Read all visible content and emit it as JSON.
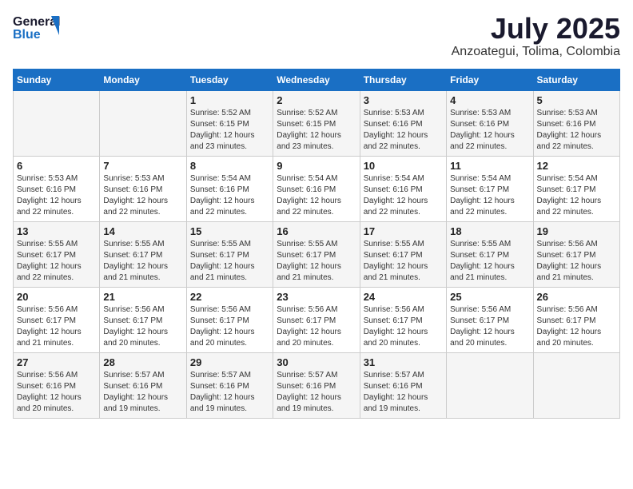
{
  "logo": {
    "line1": "General",
    "line2": "Blue"
  },
  "title": "July 2025",
  "subtitle": "Anzoategui, Tolima, Colombia",
  "weekdays": [
    "Sunday",
    "Monday",
    "Tuesday",
    "Wednesday",
    "Thursday",
    "Friday",
    "Saturday"
  ],
  "weeks": [
    [
      {
        "day": "",
        "info": ""
      },
      {
        "day": "",
        "info": ""
      },
      {
        "day": "1",
        "info": "Sunrise: 5:52 AM\nSunset: 6:15 PM\nDaylight: 12 hours and 23 minutes."
      },
      {
        "day": "2",
        "info": "Sunrise: 5:52 AM\nSunset: 6:15 PM\nDaylight: 12 hours and 23 minutes."
      },
      {
        "day": "3",
        "info": "Sunrise: 5:53 AM\nSunset: 6:16 PM\nDaylight: 12 hours and 22 minutes."
      },
      {
        "day": "4",
        "info": "Sunrise: 5:53 AM\nSunset: 6:16 PM\nDaylight: 12 hours and 22 minutes."
      },
      {
        "day": "5",
        "info": "Sunrise: 5:53 AM\nSunset: 6:16 PM\nDaylight: 12 hours and 22 minutes."
      }
    ],
    [
      {
        "day": "6",
        "info": "Sunrise: 5:53 AM\nSunset: 6:16 PM\nDaylight: 12 hours and 22 minutes."
      },
      {
        "day": "7",
        "info": "Sunrise: 5:53 AM\nSunset: 6:16 PM\nDaylight: 12 hours and 22 minutes."
      },
      {
        "day": "8",
        "info": "Sunrise: 5:54 AM\nSunset: 6:16 PM\nDaylight: 12 hours and 22 minutes."
      },
      {
        "day": "9",
        "info": "Sunrise: 5:54 AM\nSunset: 6:16 PM\nDaylight: 12 hours and 22 minutes."
      },
      {
        "day": "10",
        "info": "Sunrise: 5:54 AM\nSunset: 6:16 PM\nDaylight: 12 hours and 22 minutes."
      },
      {
        "day": "11",
        "info": "Sunrise: 5:54 AM\nSunset: 6:17 PM\nDaylight: 12 hours and 22 minutes."
      },
      {
        "day": "12",
        "info": "Sunrise: 5:54 AM\nSunset: 6:17 PM\nDaylight: 12 hours and 22 minutes."
      }
    ],
    [
      {
        "day": "13",
        "info": "Sunrise: 5:55 AM\nSunset: 6:17 PM\nDaylight: 12 hours and 22 minutes."
      },
      {
        "day": "14",
        "info": "Sunrise: 5:55 AM\nSunset: 6:17 PM\nDaylight: 12 hours and 21 minutes."
      },
      {
        "day": "15",
        "info": "Sunrise: 5:55 AM\nSunset: 6:17 PM\nDaylight: 12 hours and 21 minutes."
      },
      {
        "day": "16",
        "info": "Sunrise: 5:55 AM\nSunset: 6:17 PM\nDaylight: 12 hours and 21 minutes."
      },
      {
        "day": "17",
        "info": "Sunrise: 5:55 AM\nSunset: 6:17 PM\nDaylight: 12 hours and 21 minutes."
      },
      {
        "day": "18",
        "info": "Sunrise: 5:55 AM\nSunset: 6:17 PM\nDaylight: 12 hours and 21 minutes."
      },
      {
        "day": "19",
        "info": "Sunrise: 5:56 AM\nSunset: 6:17 PM\nDaylight: 12 hours and 21 minutes."
      }
    ],
    [
      {
        "day": "20",
        "info": "Sunrise: 5:56 AM\nSunset: 6:17 PM\nDaylight: 12 hours and 21 minutes."
      },
      {
        "day": "21",
        "info": "Sunrise: 5:56 AM\nSunset: 6:17 PM\nDaylight: 12 hours and 20 minutes."
      },
      {
        "day": "22",
        "info": "Sunrise: 5:56 AM\nSunset: 6:17 PM\nDaylight: 12 hours and 20 minutes."
      },
      {
        "day": "23",
        "info": "Sunrise: 5:56 AM\nSunset: 6:17 PM\nDaylight: 12 hours and 20 minutes."
      },
      {
        "day": "24",
        "info": "Sunrise: 5:56 AM\nSunset: 6:17 PM\nDaylight: 12 hours and 20 minutes."
      },
      {
        "day": "25",
        "info": "Sunrise: 5:56 AM\nSunset: 6:17 PM\nDaylight: 12 hours and 20 minutes."
      },
      {
        "day": "26",
        "info": "Sunrise: 5:56 AM\nSunset: 6:17 PM\nDaylight: 12 hours and 20 minutes."
      }
    ],
    [
      {
        "day": "27",
        "info": "Sunrise: 5:56 AM\nSunset: 6:16 PM\nDaylight: 12 hours and 20 minutes."
      },
      {
        "day": "28",
        "info": "Sunrise: 5:57 AM\nSunset: 6:16 PM\nDaylight: 12 hours and 19 minutes."
      },
      {
        "day": "29",
        "info": "Sunrise: 5:57 AM\nSunset: 6:16 PM\nDaylight: 12 hours and 19 minutes."
      },
      {
        "day": "30",
        "info": "Sunrise: 5:57 AM\nSunset: 6:16 PM\nDaylight: 12 hours and 19 minutes."
      },
      {
        "day": "31",
        "info": "Sunrise: 5:57 AM\nSunset: 6:16 PM\nDaylight: 12 hours and 19 minutes."
      },
      {
        "day": "",
        "info": ""
      },
      {
        "day": "",
        "info": ""
      }
    ]
  ]
}
